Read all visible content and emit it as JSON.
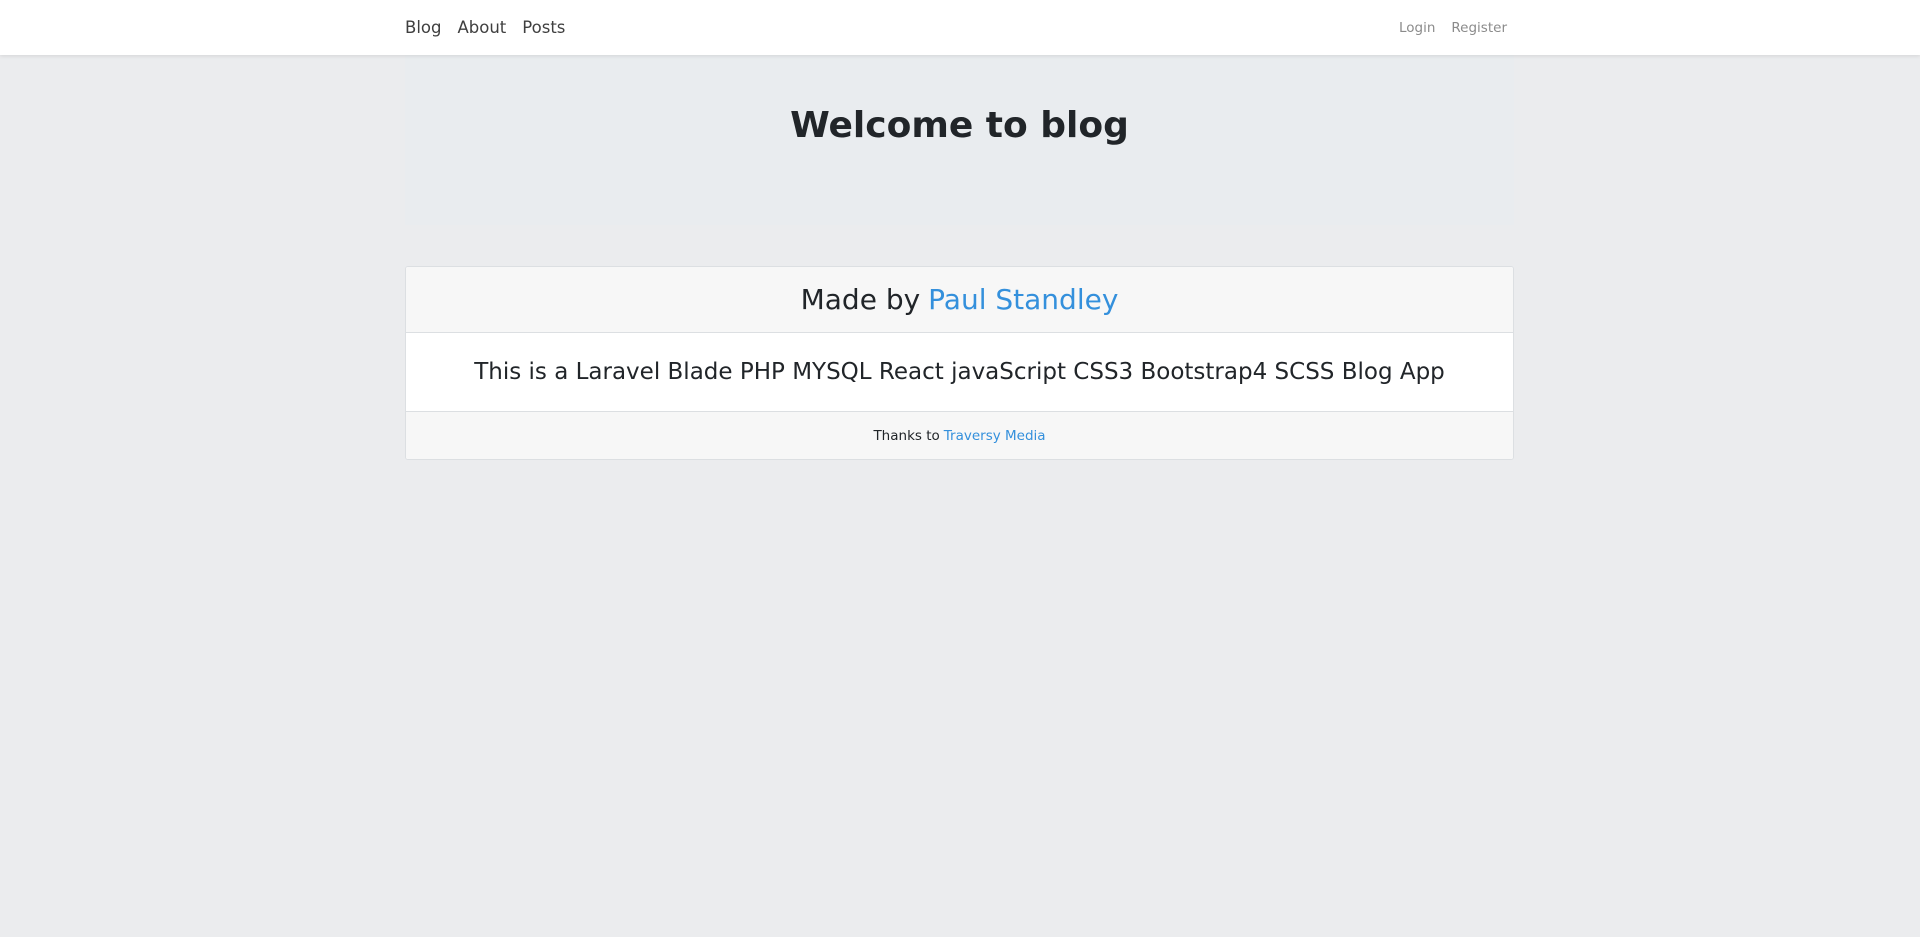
{
  "navbar": {
    "left_links": [
      "Blog",
      "About",
      "Posts"
    ],
    "right_links": [
      "Login",
      "Register"
    ]
  },
  "jumbotron": {
    "title": "Welcome to blog"
  },
  "card": {
    "header_prefix": "Made by",
    "header_link": "Paul Standley",
    "body_text": "This is a Laravel Blade PHP MYSQL React javaScript CSS3 Bootstrap4 SCSS Blog App",
    "footer_prefix": "Thanks to",
    "footer_link": "Traversy Media"
  },
  "colors": {
    "background": "#ebecee",
    "link": "#3490dc",
    "jumbotron": "#e9ecef"
  }
}
